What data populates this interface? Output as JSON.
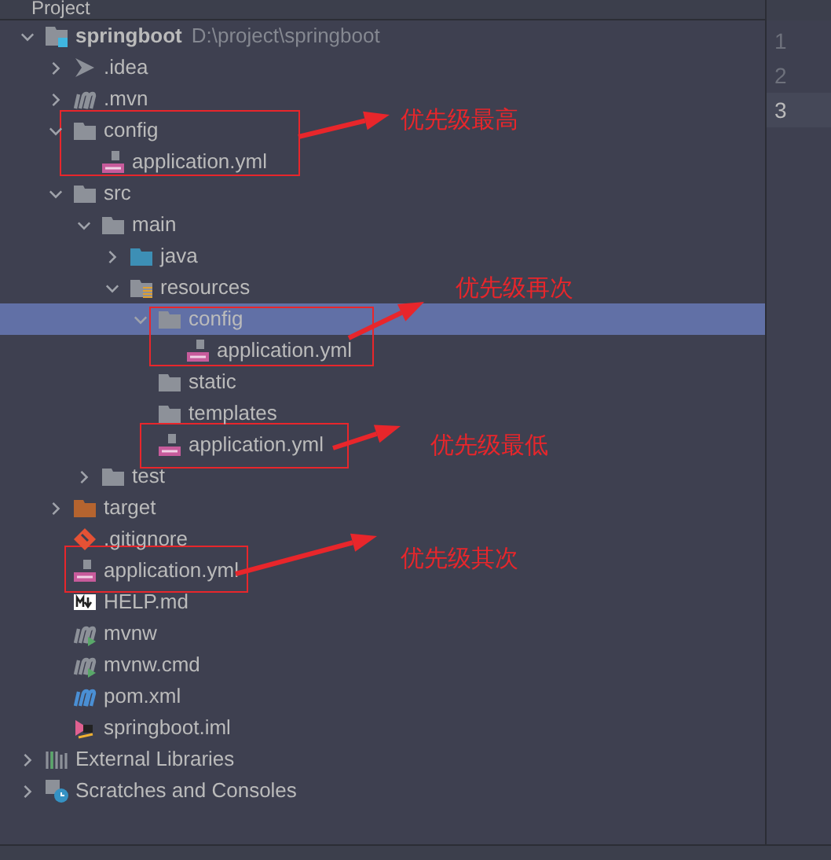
{
  "panel": {
    "title": "Project"
  },
  "tree": [
    {
      "label": "springboot",
      "path": "D:\\project\\springboot",
      "kind": "module",
      "expanded": true,
      "selected": false,
      "children": [
        {
          "label": ".idea",
          "kind": "idea",
          "expanded": false,
          "selected": false
        },
        {
          "label": ".mvn",
          "kind": "maven",
          "expanded": false,
          "selected": false
        },
        {
          "label": "config",
          "kind": "folder",
          "expanded": true,
          "selected": false,
          "children": [
            {
              "label": "application.yml",
              "kind": "yml",
              "selected": false
            }
          ]
        },
        {
          "label": "src",
          "kind": "folder",
          "expanded": true,
          "selected": false,
          "children": [
            {
              "label": "main",
              "kind": "folder",
              "expanded": true,
              "selected": false,
              "children": [
                {
                  "label": "java",
                  "kind": "source",
                  "expanded": false,
                  "selected": false
                },
                {
                  "label": "resources",
                  "kind": "resources",
                  "expanded": true,
                  "selected": false,
                  "children": [
                    {
                      "label": "config",
                      "kind": "folder",
                      "expanded": true,
                      "selected": true,
                      "children": [
                        {
                          "label": "application.yml",
                          "kind": "yml",
                          "selected": false
                        }
                      ]
                    },
                    {
                      "label": "static",
                      "kind": "folder",
                      "selected": false
                    },
                    {
                      "label": "templates",
                      "kind": "folder",
                      "selected": false
                    },
                    {
                      "label": "application.yml",
                      "kind": "yml",
                      "selected": false
                    }
                  ]
                }
              ]
            },
            {
              "label": "test",
              "kind": "folder",
              "expanded": false,
              "selected": false
            }
          ]
        },
        {
          "label": "target",
          "kind": "excluded",
          "expanded": false,
          "selected": false
        },
        {
          "label": ".gitignore",
          "kind": "git",
          "selected": false
        },
        {
          "label": "application.yml",
          "kind": "yml",
          "selected": false
        },
        {
          "label": "HELP.md",
          "kind": "markdown",
          "selected": false
        },
        {
          "label": "mvnw",
          "kind": "maven-run",
          "selected": false
        },
        {
          "label": "mvnw.cmd",
          "kind": "maven-run",
          "selected": false
        },
        {
          "label": "pom.xml",
          "kind": "maven-blue",
          "selected": false
        },
        {
          "label": "springboot.iml",
          "kind": "iml",
          "selected": false
        }
      ]
    },
    {
      "label": "External Libraries",
      "kind": "libraries",
      "expanded": false,
      "selected": false
    },
    {
      "label": "Scratches and Consoles",
      "kind": "scratches",
      "expanded": false,
      "selected": false
    }
  ],
  "annotations": [
    {
      "text": "优先级最高"
    },
    {
      "text": "优先级再次"
    },
    {
      "text": "优先级最低"
    },
    {
      "text": "优先级其次"
    }
  ],
  "gutter": [
    {
      "number": "1",
      "current": false
    },
    {
      "number": "2",
      "current": false
    },
    {
      "number": "3",
      "current": true
    }
  ]
}
